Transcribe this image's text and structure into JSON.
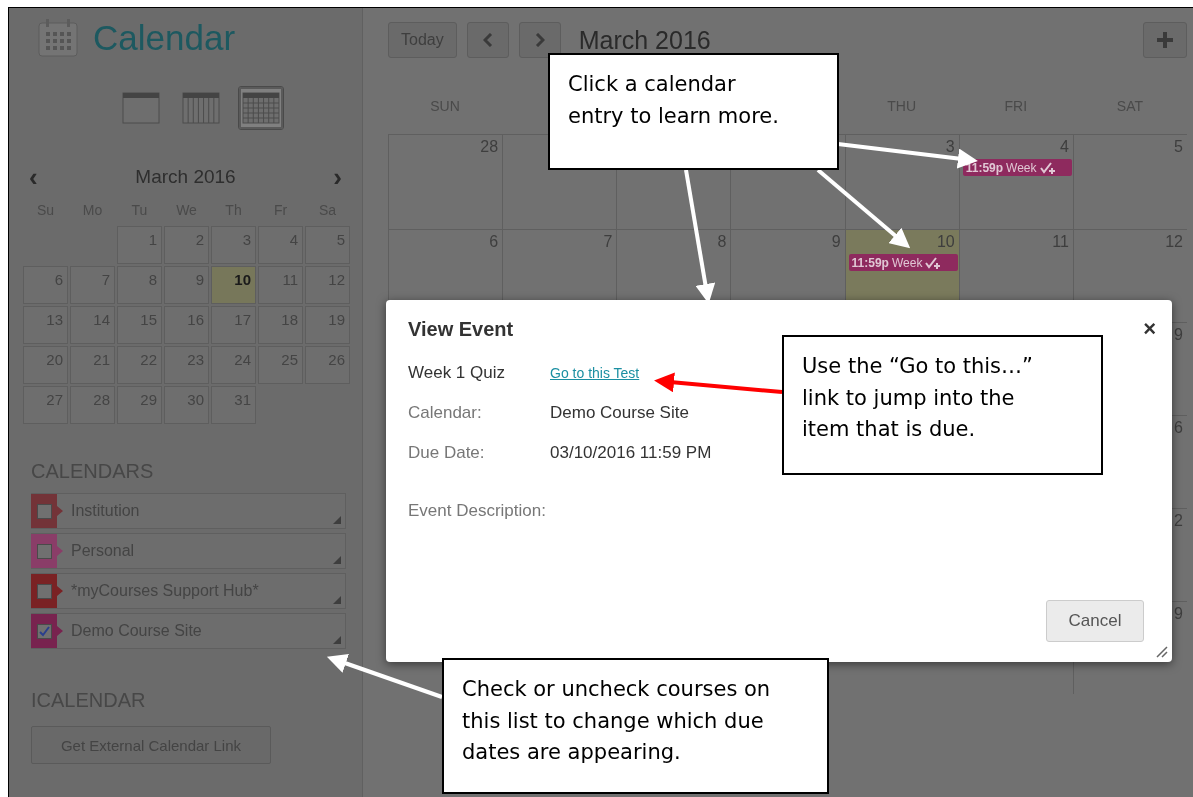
{
  "sidebar": {
    "title": "Calendar",
    "views": [
      {
        "kind": "day",
        "selected": false
      },
      {
        "kind": "week",
        "selected": false
      },
      {
        "kind": "month",
        "selected": true
      }
    ],
    "mini_calendar": {
      "month": "March 2016",
      "prev": "‹",
      "next": "›",
      "weekdays": [
        "Su",
        "Mo",
        "Tu",
        "We",
        "Th",
        "Fr",
        "Sa"
      ],
      "weeks": [
        [
          {
            "day": "1",
            "today": false
          },
          {
            "day": "2",
            "today": false
          },
          {
            "day": "3",
            "today": false
          },
          {
            "day": "4",
            "today": false
          },
          {
            "day": "5",
            "today": false
          }
        ],
        [
          {
            "day": "6",
            "today": false
          },
          {
            "day": "7",
            "today": false
          },
          {
            "day": "8",
            "today": false
          },
          {
            "day": "9",
            "today": false
          },
          {
            "day": "10",
            "today": true
          },
          {
            "day": "11",
            "today": false
          },
          {
            "day": "12",
            "today": false
          }
        ],
        [
          {
            "day": "13",
            "today": false
          },
          {
            "day": "14",
            "today": false
          },
          {
            "day": "15",
            "today": false
          },
          {
            "day": "16",
            "today": false
          },
          {
            "day": "17",
            "today": false
          },
          {
            "day": "18",
            "today": false
          },
          {
            "day": "19",
            "today": false
          }
        ],
        [
          {
            "day": "20",
            "today": false
          },
          {
            "day": "21",
            "today": false
          },
          {
            "day": "22",
            "today": false
          },
          {
            "day": "23",
            "today": false
          },
          {
            "day": "24",
            "today": false
          },
          {
            "day": "25",
            "today": false
          },
          {
            "day": "26",
            "today": false
          }
        ],
        [
          {
            "day": "27",
            "today": false
          },
          {
            "day": "28",
            "today": false
          },
          {
            "day": "29",
            "today": false
          },
          {
            "day": "30",
            "today": false
          },
          {
            "day": "31",
            "today": false
          }
        ]
      ]
    },
    "calendars_heading": "CALENDARS",
    "calendars": [
      {
        "name": "Institution",
        "checked": false,
        "color": "#733338"
      },
      {
        "name": "Personal",
        "checked": false,
        "color": "#8a3d68"
      },
      {
        "name": "*myCourses Support Hub*",
        "checked": false,
        "color": "#7a2224"
      },
      {
        "name": "Demo Course Site",
        "checked": true,
        "color": "#78234f"
      }
    ],
    "icalendar_heading": "ICALENDAR",
    "external_link_button": "Get External Calendar Link"
  },
  "main": {
    "today_button": "Today",
    "title": "March 2016",
    "weekdays": [
      {
        "kind": "sun",
        "label": "SUN"
      },
      {
        "kind": "thu",
        "label": "THU"
      },
      {
        "kind": "fri",
        "label": "FRI"
      },
      {
        "kind": "sat",
        "label": "SAT"
      }
    ],
    "weeks": [
      [
        {
          "kind": "sun",
          "day": "28",
          "today": false
        },
        {
          "kind": "thu",
          "day": "3",
          "today": false
        },
        {
          "kind": "fri",
          "day": "4",
          "today": false,
          "events": [
            {
              "time": "11:59p",
              "title": "Week"
            }
          ]
        },
        {
          "kind": "sat",
          "day": "5",
          "today": false
        }
      ],
      [
        {
          "kind": "sun",
          "day": "6",
          "today": false
        },
        {
          "kind": "mon",
          "day": "7",
          "today": false
        },
        {
          "kind": "tue",
          "day": "8",
          "today": false
        },
        {
          "kind": "wed",
          "day": "9",
          "today": false
        },
        {
          "kind": "thu",
          "day": "10",
          "today": true,
          "events": [
            {
              "time": "11:59p",
              "title": "Week"
            }
          ]
        },
        {
          "kind": "fri",
          "day": "11",
          "today": false
        },
        {
          "kind": "sat",
          "day": "12",
          "today": false
        }
      ],
      [
        {
          "kind": "sat",
          "day": "9",
          "today": false
        }
      ],
      [
        {
          "kind": "sat",
          "day": "6",
          "today": false
        }
      ],
      [
        {
          "kind": "sat",
          "day": "2",
          "today": false
        }
      ],
      [
        {
          "kind": "sat",
          "day": "9",
          "today": false
        }
      ]
    ]
  },
  "dialog": {
    "title": "View Event",
    "close": "×",
    "event_name": "Week 1 Quiz",
    "link": "Go to this Test",
    "fields": [
      {
        "label": "Calendar:",
        "value": "Demo Course Site"
      },
      {
        "label": "Due Date:",
        "value": "03/10/2016 11:59 PM"
      },
      {
        "label": "Event Description:"
      }
    ],
    "cancel_button": "Cancel"
  },
  "callouts": [
    {
      "text": "Click a calendar entry to learn more."
    },
    {
      "text": "Use the “Go to this…” link to jump into the item that is due."
    },
    {
      "text": "Check or uncheck courses on this list to change which due dates are appearing."
    }
  ]
}
